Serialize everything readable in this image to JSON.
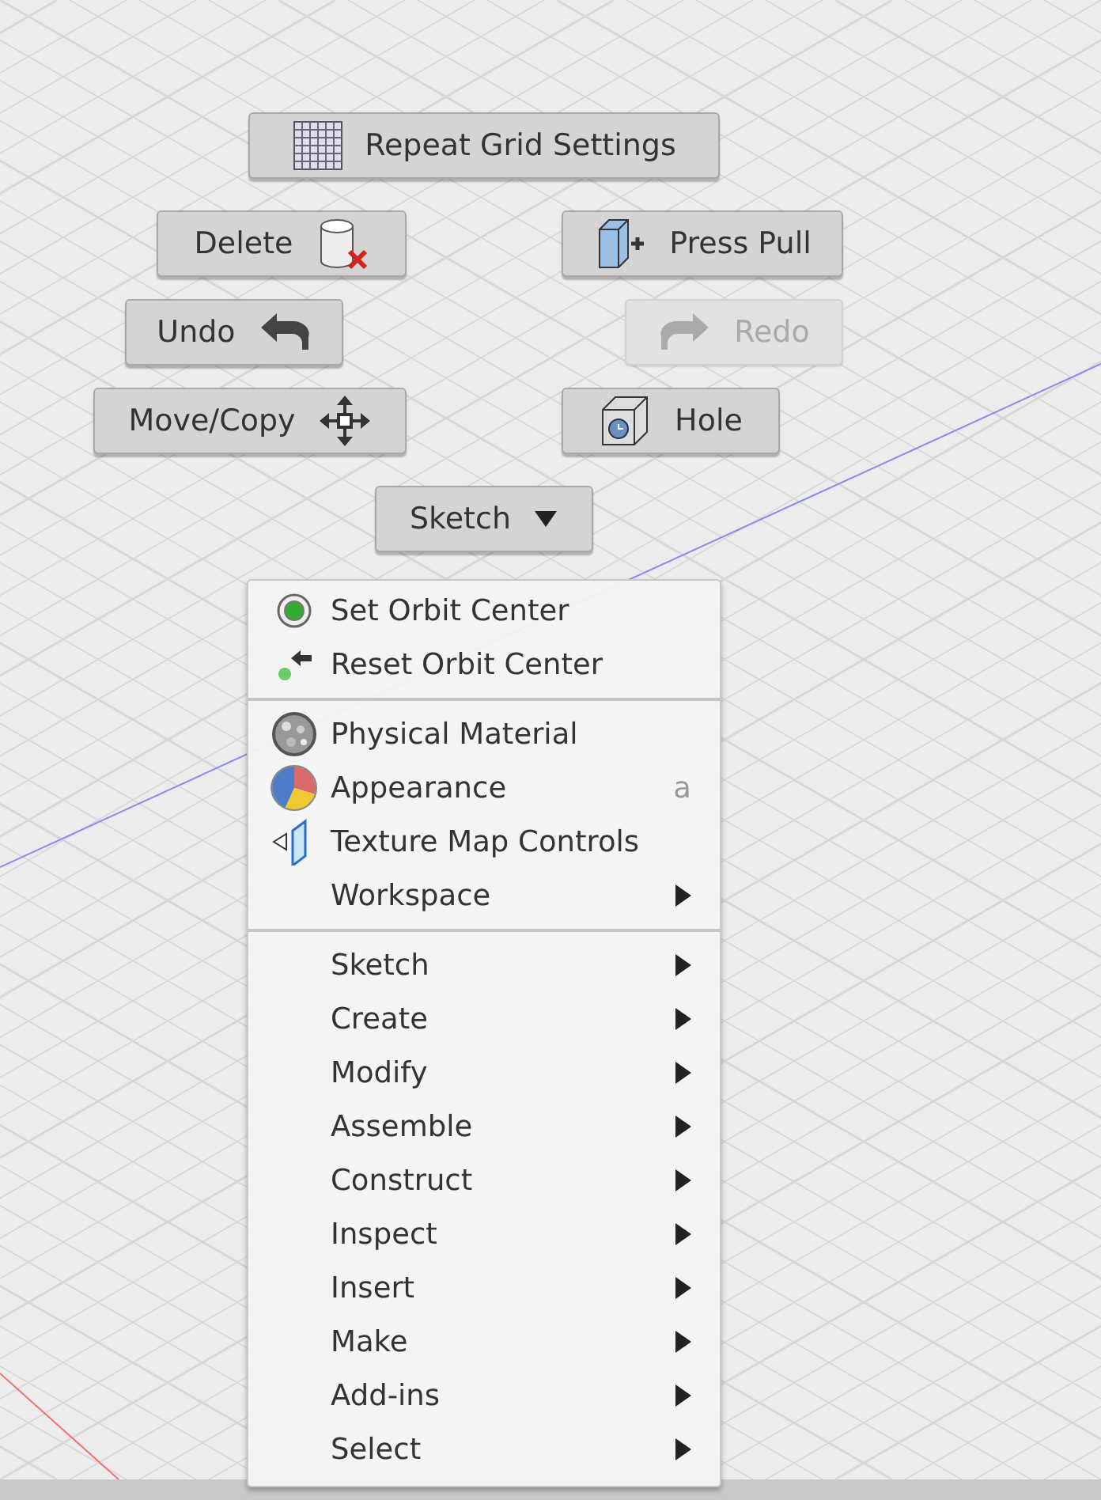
{
  "buttons": [
    {
      "label": "Repeat Grid Settings",
      "kind": "grid",
      "disabled": false
    },
    {
      "label": "Delete",
      "kind": "delete",
      "disabled": false
    },
    {
      "label": "Press Pull",
      "kind": "presspull",
      "disabled": false
    },
    {
      "label": "Undo",
      "kind": "undo",
      "disabled": false
    },
    {
      "label": "Redo",
      "kind": "redo",
      "disabled": true
    },
    {
      "label": "Move/Copy",
      "kind": "move",
      "disabled": false
    },
    {
      "label": "Hole",
      "kind": "hole",
      "disabled": false
    },
    {
      "label": "Sketch",
      "kind": "dropdown",
      "disabled": false
    }
  ],
  "context_menu": {
    "sections": [
      [
        {
          "label": "Set Orbit Center",
          "kind": "orbit"
        },
        {
          "label": "Reset Orbit Center",
          "kind": "resetorbit"
        }
      ],
      [
        {
          "label": "Physical Material",
          "kind": "material"
        },
        {
          "label": "Appearance",
          "kind": "appearance",
          "shortcut": "a"
        },
        {
          "label": "Texture Map Controls",
          "kind": "texture"
        },
        {
          "label": "Workspace",
          "submenu": true
        }
      ],
      [
        {
          "label": "Sketch",
          "submenu": true
        },
        {
          "label": "Create",
          "submenu": true
        },
        {
          "label": "Modify",
          "submenu": true
        },
        {
          "label": "Assemble",
          "submenu": true
        },
        {
          "label": "Construct",
          "submenu": true
        },
        {
          "label": "Inspect",
          "submenu": true
        },
        {
          "label": "Insert",
          "submenu": true
        },
        {
          "label": "Make",
          "submenu": true
        },
        {
          "label": "Add-ins",
          "submenu": true
        },
        {
          "label": "Select",
          "submenu": true
        }
      ]
    ]
  }
}
